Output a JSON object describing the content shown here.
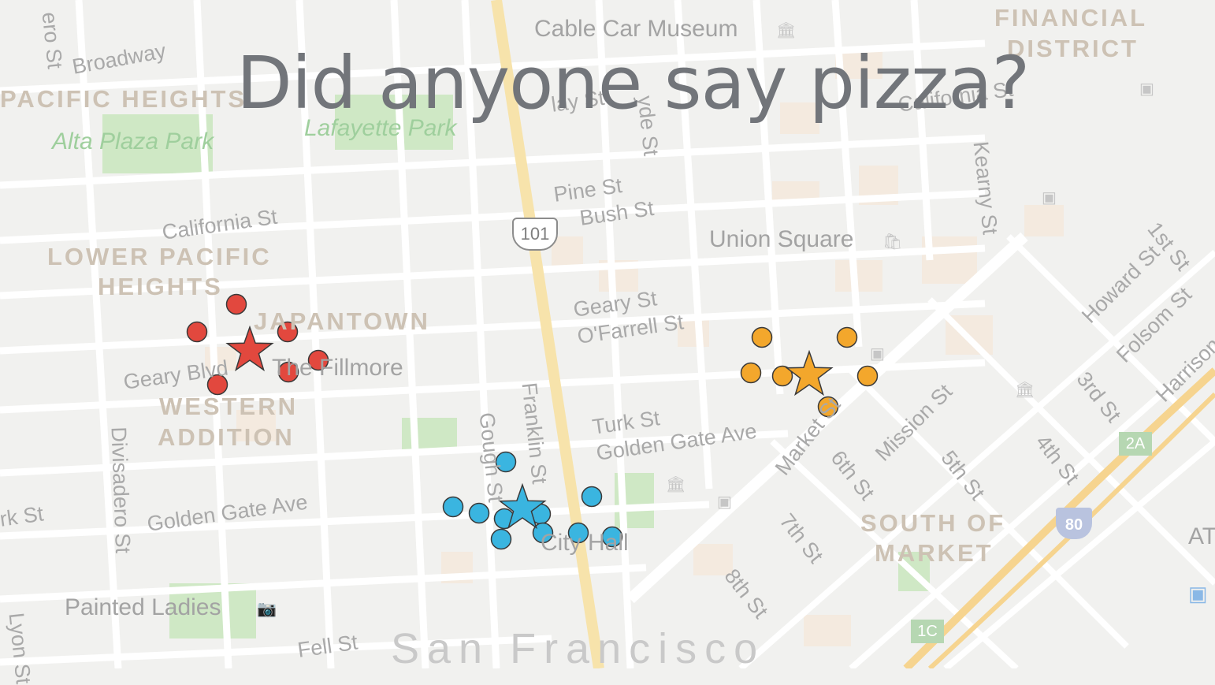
{
  "title": "Did anyone say pizza?",
  "colors": {
    "red_cluster": "#e2483e",
    "blue_cluster": "#3ab5e0",
    "orange_cluster": "#f3a72c",
    "water_street_main": "#f7e3ab",
    "park_green": "#cfe8c5"
  },
  "highway_shield": "101",
  "interstate_shield": "80",
  "exits": [
    "2A",
    "1C"
  ],
  "poi_icons": [
    "museum-icon",
    "shopping-bag-icon",
    "transit-icon",
    "camera-icon"
  ],
  "map_labels": {
    "cable_car_museum": "Cable Car Museum",
    "financial_district_1": "FINANCIAL",
    "financial_district_2": "DISTRICT",
    "broadway": "Broadway",
    "pacific_heights": "PACIFIC HEIGHTS",
    "lafayette_park": "Lafayette Park",
    "alta_plaza_park": "Alta Plaza Park",
    "california_st_west": "California St",
    "california_st_east": "California St",
    "pine_st": "Pine St",
    "bush_st": "Bush St",
    "union_square": "Union Square",
    "lower_pacific_heights_1": "LOWER PACIFIC",
    "lower_pacific_heights_2": "HEIGHTS",
    "japantown": "JAPANTOWN",
    "geary_st": "Geary St",
    "ofarrell_st": "O'Farrell St",
    "geary_blvd": "Geary Blvd",
    "the_fillmore": "The Fillmore",
    "western_addition_1": "WESTERN",
    "western_addition_2": "ADDITION",
    "divisadero_st": "Divisadero St",
    "gough_st": "Gough St",
    "franklin_st": "Franklin St",
    "turk_st": "Turk St",
    "golden_gate_ave_east": "Golden Gate Ave",
    "golden_gate_ave_west": "Golden Gate Ave",
    "city_hall": "City Hall",
    "market_st": "Market St",
    "sixth_st": "6th St",
    "mission_st": "Mission St",
    "fifth_st": "5th St",
    "fourth_st": "4th St",
    "third_st": "3rd St",
    "first_st": "1st St",
    "howard_st": "Howard St",
    "folsom_st": "Folsom St",
    "harrison_st": "Harrison St",
    "seventh_st": "7th St",
    "eighth_st": "8th St",
    "south_of_market_1": "SOUTH OF",
    "south_of_market_2": "MARKET",
    "kearny_st": "Kearny St",
    "turk_st_west": "rk St",
    "painted_ladies": "Painted Ladies",
    "fell_st": "Fell St",
    "san_francisco": "San Francisco",
    "hyde_st": "yde St",
    "clay_st": "lay St",
    "lyon_st": "Lyon St",
    "edge_st": "ero St",
    "at_edge": "AT"
  }
}
